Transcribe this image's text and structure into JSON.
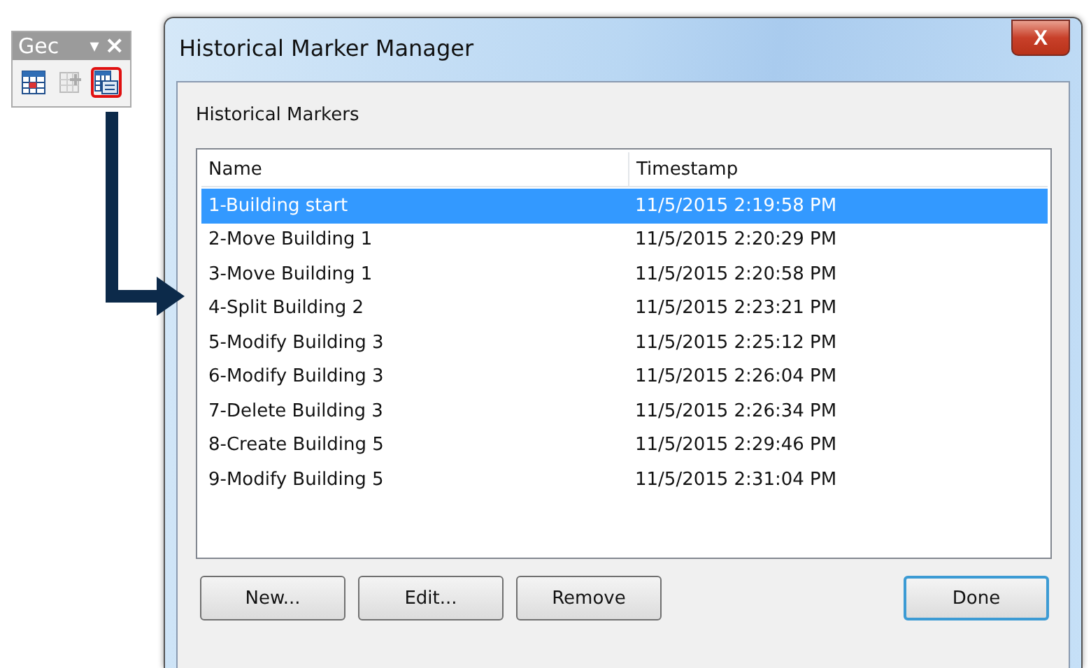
{
  "toolbar": {
    "title": "Gec",
    "menu_glyph": "▾",
    "close_glyph": "×",
    "tools": [
      {
        "kind": "table",
        "highlighted": false
      },
      {
        "kind": "add",
        "highlighted": false
      },
      {
        "kind": "markers",
        "highlighted": true
      }
    ]
  },
  "dialog": {
    "title": "Historical Marker Manager",
    "close_glyph": "X",
    "group_label": "Historical Markers",
    "table": {
      "columns": [
        "Name",
        "Timestamp"
      ],
      "rows": [
        {
          "cells": [
            "1-Building start",
            "11/5/2015 2:19:58 PM"
          ],
          "selected": true
        },
        {
          "cells": [
            "2-Move Building 1",
            "11/5/2015 2:20:29 PM"
          ],
          "selected": false
        },
        {
          "cells": [
            "3-Move Building 1",
            "11/5/2015 2:20:58 PM"
          ],
          "selected": false
        },
        {
          "cells": [
            "4-Split Building 2",
            "11/5/2015 2:23:21 PM"
          ],
          "selected": false
        },
        {
          "cells": [
            "5-Modify Building 3",
            "11/5/2015 2:25:12 PM"
          ],
          "selected": false
        },
        {
          "cells": [
            "6-Modify Building 3",
            "11/5/2015 2:26:04 PM"
          ],
          "selected": false
        },
        {
          "cells": [
            "7-Delete Building 3",
            "11/5/2015 2:26:34 PM"
          ],
          "selected": false
        },
        {
          "cells": [
            "8-Create Building 5",
            "11/5/2015 2:29:46 PM"
          ],
          "selected": false
        },
        {
          "cells": [
            "9-Modify Building 5",
            "11/5/2015 2:31:04 PM"
          ],
          "selected": false
        }
      ]
    },
    "buttons": [
      {
        "label": "New...",
        "default": false
      },
      {
        "label": "Edit...",
        "default": false
      },
      {
        "label": "Remove",
        "default": false
      },
      {
        "label": "Done",
        "default": true
      }
    ]
  }
}
